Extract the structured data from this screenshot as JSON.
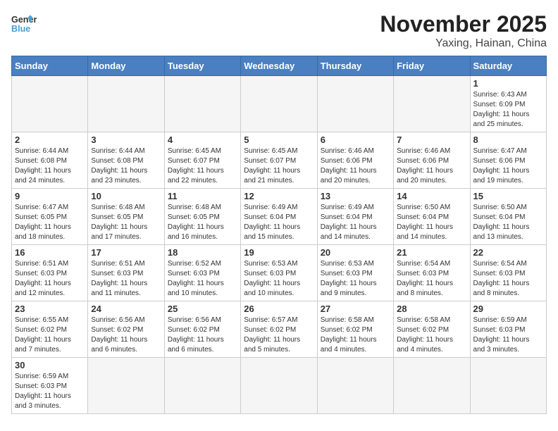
{
  "header": {
    "logo_general": "General",
    "logo_blue": "Blue",
    "month_year": "November 2025",
    "location": "Yaxing, Hainan, China"
  },
  "days_of_week": [
    "Sunday",
    "Monday",
    "Tuesday",
    "Wednesday",
    "Thursday",
    "Friday",
    "Saturday"
  ],
  "weeks": [
    [
      {
        "day": "",
        "info": ""
      },
      {
        "day": "",
        "info": ""
      },
      {
        "day": "",
        "info": ""
      },
      {
        "day": "",
        "info": ""
      },
      {
        "day": "",
        "info": ""
      },
      {
        "day": "",
        "info": ""
      },
      {
        "day": "1",
        "info": "Sunrise: 6:43 AM\nSunset: 6:09 PM\nDaylight: 11 hours\nand 25 minutes."
      }
    ],
    [
      {
        "day": "2",
        "info": "Sunrise: 6:44 AM\nSunset: 6:08 PM\nDaylight: 11 hours\nand 24 minutes."
      },
      {
        "day": "3",
        "info": "Sunrise: 6:44 AM\nSunset: 6:08 PM\nDaylight: 11 hours\nand 23 minutes."
      },
      {
        "day": "4",
        "info": "Sunrise: 6:45 AM\nSunset: 6:07 PM\nDaylight: 11 hours\nand 22 minutes."
      },
      {
        "day": "5",
        "info": "Sunrise: 6:45 AM\nSunset: 6:07 PM\nDaylight: 11 hours\nand 21 minutes."
      },
      {
        "day": "6",
        "info": "Sunrise: 6:46 AM\nSunset: 6:06 PM\nDaylight: 11 hours\nand 20 minutes."
      },
      {
        "day": "7",
        "info": "Sunrise: 6:46 AM\nSunset: 6:06 PM\nDaylight: 11 hours\nand 20 minutes."
      },
      {
        "day": "8",
        "info": "Sunrise: 6:47 AM\nSunset: 6:06 PM\nDaylight: 11 hours\nand 19 minutes."
      }
    ],
    [
      {
        "day": "9",
        "info": "Sunrise: 6:47 AM\nSunset: 6:05 PM\nDaylight: 11 hours\nand 18 minutes."
      },
      {
        "day": "10",
        "info": "Sunrise: 6:48 AM\nSunset: 6:05 PM\nDaylight: 11 hours\nand 17 minutes."
      },
      {
        "day": "11",
        "info": "Sunrise: 6:48 AM\nSunset: 6:05 PM\nDaylight: 11 hours\nand 16 minutes."
      },
      {
        "day": "12",
        "info": "Sunrise: 6:49 AM\nSunset: 6:04 PM\nDaylight: 11 hours\nand 15 minutes."
      },
      {
        "day": "13",
        "info": "Sunrise: 6:49 AM\nSunset: 6:04 PM\nDaylight: 11 hours\nand 14 minutes."
      },
      {
        "day": "14",
        "info": "Sunrise: 6:50 AM\nSunset: 6:04 PM\nDaylight: 11 hours\nand 14 minutes."
      },
      {
        "day": "15",
        "info": "Sunrise: 6:50 AM\nSunset: 6:04 PM\nDaylight: 11 hours\nand 13 minutes."
      }
    ],
    [
      {
        "day": "16",
        "info": "Sunrise: 6:51 AM\nSunset: 6:03 PM\nDaylight: 11 hours\nand 12 minutes."
      },
      {
        "day": "17",
        "info": "Sunrise: 6:51 AM\nSunset: 6:03 PM\nDaylight: 11 hours\nand 11 minutes."
      },
      {
        "day": "18",
        "info": "Sunrise: 6:52 AM\nSunset: 6:03 PM\nDaylight: 11 hours\nand 10 minutes."
      },
      {
        "day": "19",
        "info": "Sunrise: 6:53 AM\nSunset: 6:03 PM\nDaylight: 11 hours\nand 10 minutes."
      },
      {
        "day": "20",
        "info": "Sunrise: 6:53 AM\nSunset: 6:03 PM\nDaylight: 11 hours\nand 9 minutes."
      },
      {
        "day": "21",
        "info": "Sunrise: 6:54 AM\nSunset: 6:03 PM\nDaylight: 11 hours\nand 8 minutes."
      },
      {
        "day": "22",
        "info": "Sunrise: 6:54 AM\nSunset: 6:03 PM\nDaylight: 11 hours\nand 8 minutes."
      }
    ],
    [
      {
        "day": "23",
        "info": "Sunrise: 6:55 AM\nSunset: 6:02 PM\nDaylight: 11 hours\nand 7 minutes."
      },
      {
        "day": "24",
        "info": "Sunrise: 6:56 AM\nSunset: 6:02 PM\nDaylight: 11 hours\nand 6 minutes."
      },
      {
        "day": "25",
        "info": "Sunrise: 6:56 AM\nSunset: 6:02 PM\nDaylight: 11 hours\nand 6 minutes."
      },
      {
        "day": "26",
        "info": "Sunrise: 6:57 AM\nSunset: 6:02 PM\nDaylight: 11 hours\nand 5 minutes."
      },
      {
        "day": "27",
        "info": "Sunrise: 6:58 AM\nSunset: 6:02 PM\nDaylight: 11 hours\nand 4 minutes."
      },
      {
        "day": "28",
        "info": "Sunrise: 6:58 AM\nSunset: 6:02 PM\nDaylight: 11 hours\nand 4 minutes."
      },
      {
        "day": "29",
        "info": "Sunrise: 6:59 AM\nSunset: 6:03 PM\nDaylight: 11 hours\nand 3 minutes."
      }
    ],
    [
      {
        "day": "30",
        "info": "Sunrise: 6:59 AM\nSunset: 6:03 PM\nDaylight: 11 hours\nand 3 minutes."
      },
      {
        "day": "",
        "info": ""
      },
      {
        "day": "",
        "info": ""
      },
      {
        "day": "",
        "info": ""
      },
      {
        "day": "",
        "info": ""
      },
      {
        "day": "",
        "info": ""
      },
      {
        "day": "",
        "info": ""
      }
    ]
  ]
}
